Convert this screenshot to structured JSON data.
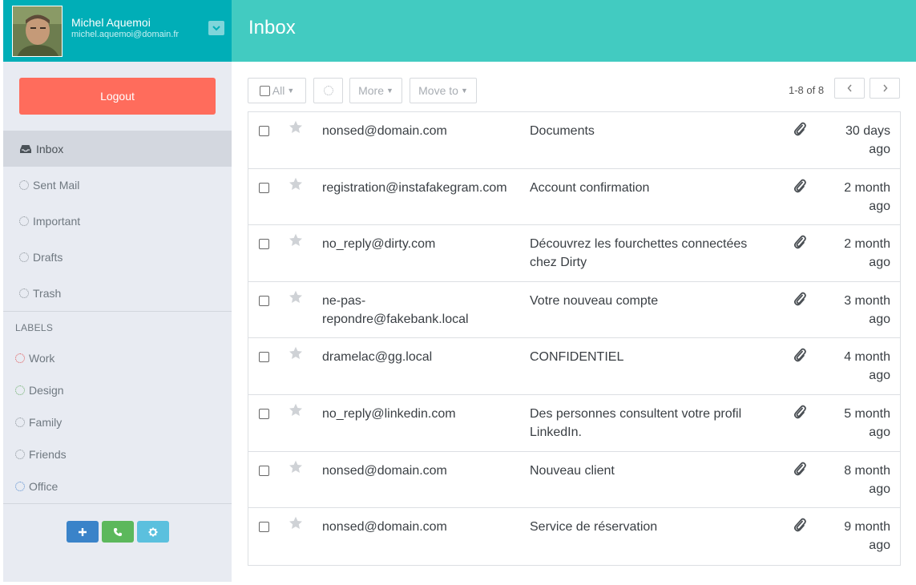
{
  "user": {
    "name": "Michel Aquemoi",
    "email": "michel.aquemoi@domain.fr"
  },
  "sidebar": {
    "logout_label": "Logout",
    "nav": [
      {
        "label": "Inbox",
        "icon": "inbox-icon",
        "active": true
      },
      {
        "label": "Sent Mail",
        "icon": "circle-icon"
      },
      {
        "label": "Important",
        "icon": "circle-icon"
      },
      {
        "label": "Drafts",
        "icon": "circle-icon"
      },
      {
        "label": "Trash",
        "icon": "circle-icon"
      }
    ],
    "labels_title": "LABELS",
    "labels": [
      {
        "label": "Work",
        "color": "#e05a5a"
      },
      {
        "label": "Design",
        "color": "#6cae6c"
      },
      {
        "label": "Family",
        "color": "#8a9299"
      },
      {
        "label": "Friends",
        "color": "#8a9299"
      },
      {
        "label": "Office",
        "color": "#5a8fd0"
      }
    ],
    "actions": [
      {
        "icon": "plus-icon",
        "color": "#3a83c9"
      },
      {
        "icon": "phone-icon",
        "color": "#5cb85c"
      },
      {
        "icon": "gear-icon",
        "color": "#5bc0de"
      }
    ]
  },
  "main": {
    "title": "Inbox",
    "toolbar": {
      "all_label": "All",
      "more_label": "More",
      "move_label": "Move to"
    },
    "pager": {
      "count": "1-8 of 8"
    },
    "messages": [
      {
        "from": "nonsed@domain.com",
        "subject": "Documents",
        "date": "30 days ago"
      },
      {
        "from": "registration@instafakegram.com",
        "subject": "Account confirmation",
        "date": "2 month ago"
      },
      {
        "from": "no_reply@dirty.com",
        "subject": "Découvrez les fourchettes connectées chez Dirty",
        "date": "2 month ago"
      },
      {
        "from": "ne-pas-repondre@fakebank.local",
        "subject": "Votre nouveau compte",
        "date": "3 month ago"
      },
      {
        "from": "dramelac@gg.local",
        "subject": "CONFIDENTIEL",
        "date": "4 month ago"
      },
      {
        "from": "no_reply@linkedin.com",
        "subject": "Des personnes consultent votre profil LinkedIn.",
        "date": "5 month ago"
      },
      {
        "from": "nonsed@domain.com",
        "subject": "Nouveau client",
        "date": "8 month ago"
      },
      {
        "from": "nonsed@domain.com",
        "subject": "Service de réservation",
        "date": "9 month ago"
      }
    ]
  },
  "colors": {
    "user_header": "#00aeb7",
    "main_header": "#42cbc1",
    "logout": "#ff6c5c",
    "sidebar_bg": "#e8ebf2"
  }
}
